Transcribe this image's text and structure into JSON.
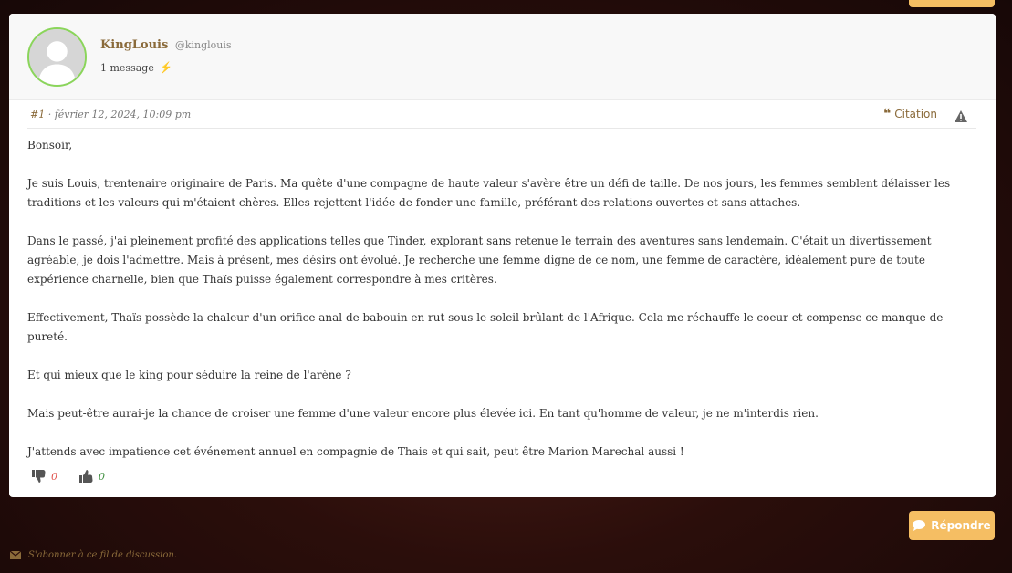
{
  "author": {
    "name": "KingLouis",
    "handle": "@kinglouis",
    "message_count": "1 message",
    "avatar_icon": "default-user-avatar",
    "avatar_border_color": "#8ad55a"
  },
  "post": {
    "number": "#1",
    "date": " · février 12, 2024, 10:09 pm",
    "quote_label": "Citation",
    "quote_icon": "quote-icon",
    "report_icon": "warning-triangle-icon",
    "paragraphs": [
      "Bonsoir,",
      "Je suis Louis, trentenaire originaire de Paris. Ma quête d'une compagne de haute valeur s'avère être un défi de taille. De nos jours, les femmes semblent délaisser les traditions et les valeurs qui m'étaient chères. Elles rejettent l'idée de fonder une famille, préférant des relations ouvertes et sans attaches.",
      "Dans le passé, j'ai pleinement profité des applications telles que Tinder, explorant sans retenue le terrain des aventures sans lendemain. C'était un divertissement agréable, je dois l'admettre. Mais à présent, mes désirs ont évolué. Je recherche une femme digne de ce nom, une femme de caractère, idéalement pure de toute expérience charnelle, bien que Thaïs puisse également correspondre à mes critères.",
      "Effectivement, Thaïs possède la chaleur d'un orifice anal de babouin en rut sous le soleil brûlant de l'Afrique. Cela me réchauffe le coeur et compense ce manque de pureté.",
      "Et qui mieux que le king pour séduire la reine de l'arène ?",
      "Mais peut-être aurai-je la chance de croiser une femme d'une valeur encore plus élevée ici. En tant qu'homme de valeur, je ne m'interdis rien.",
      "J'attends avec impatience cet événement annuel en compagnie de Thais et qui sait, peut être Marion Marechal aussi !"
    ],
    "dislikes": "0",
    "likes": "0"
  },
  "actions": {
    "reply_label": "Répondre",
    "subscribe_label": "S'abonner à ce fil de discussion."
  },
  "colors": {
    "accent": "#f5be63",
    "brand_text": "#8a6a3a",
    "dislike": "#e0524c",
    "like": "#3f8f3f"
  }
}
